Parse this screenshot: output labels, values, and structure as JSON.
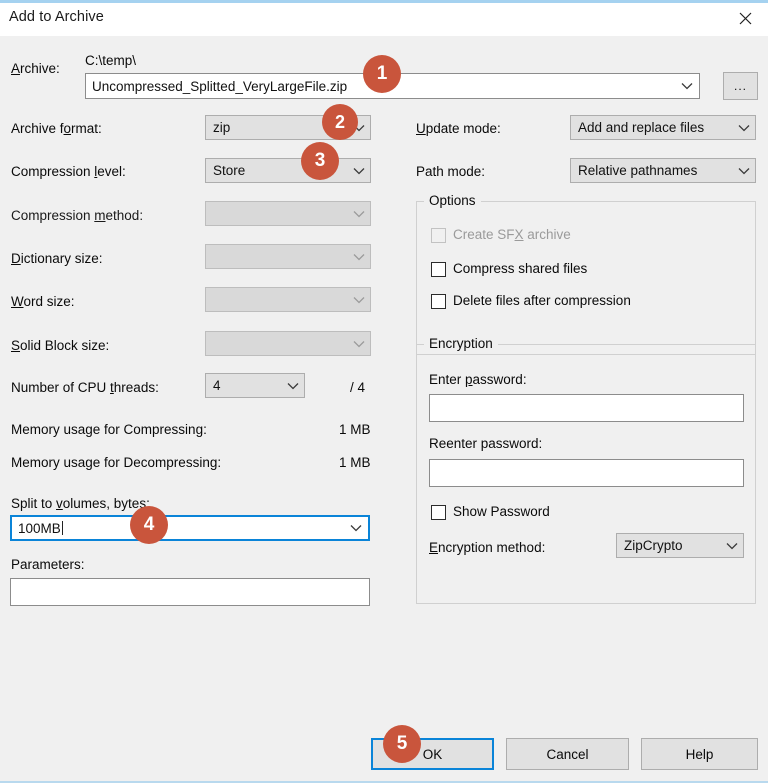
{
  "window": {
    "title": "Add to Archive",
    "close_icon": "close-icon",
    "accent_top": "#a5d2f0",
    "accent_bottom": "#b9d9ee",
    "background": "#f0f0f0",
    "focus_color": "#0a84d8",
    "badge_color": "#c9553c"
  },
  "archive": {
    "label": "Archive:",
    "path": "C:\\temp\\",
    "filename": "Uncompressed_Splitted_VeryLargeFile.zip",
    "browse_label": "...",
    "dropdown_icon": "chevron-down-icon"
  },
  "left": {
    "archive_format": {
      "label": "Archive format:",
      "value": "zip",
      "enabled": true
    },
    "compression_level": {
      "label": "Compression level:",
      "value": "Store",
      "enabled": true
    },
    "compression_method": {
      "label": "Compression method:",
      "value": "",
      "enabled": false
    },
    "dictionary_size": {
      "label": "Dictionary size:",
      "value": "",
      "enabled": false
    },
    "word_size": {
      "label": "Word size:",
      "value": "",
      "enabled": false
    },
    "solid_block_size": {
      "label": "Solid Block size:",
      "value": "",
      "enabled": false
    },
    "cpu_threads": {
      "label": "Number of CPU threads:",
      "value": "4",
      "total": "/ 4",
      "enabled": true
    },
    "memory_compressing": {
      "label": "Memory usage for Compressing:",
      "value": "1 MB"
    },
    "memory_decompressing": {
      "label": "Memory usage for Decompressing:",
      "value": "1 MB"
    },
    "split_volumes": {
      "label": "Split to volumes, bytes:",
      "value": "100MB",
      "focused": true
    },
    "parameters": {
      "label": "Parameters:",
      "value": ""
    }
  },
  "right": {
    "update_mode": {
      "label": "Update mode:",
      "value": "Add and replace files"
    },
    "path_mode": {
      "label": "Path mode:",
      "value": "Relative pathnames"
    },
    "options": {
      "title": "Options",
      "items": [
        {
          "label": "Create SFX archive",
          "checked": false,
          "enabled": false
        },
        {
          "label": "Compress shared files",
          "checked": false,
          "enabled": true
        },
        {
          "label": "Delete files after compression",
          "checked": false,
          "enabled": true
        }
      ]
    },
    "encryption": {
      "title": "Encryption",
      "enter_password_label": "Enter password:",
      "enter_password_value": "",
      "reenter_password_label": "Reenter password:",
      "reenter_password_value": "",
      "show_password_label": "Show Password",
      "show_password_checked": false,
      "method_label": "Encryption method:",
      "method_value": "ZipCrypto"
    }
  },
  "buttons": {
    "ok": "OK",
    "cancel": "Cancel",
    "help": "Help"
  },
  "annotations": [
    {
      "number": "1"
    },
    {
      "number": "2"
    },
    {
      "number": "3"
    },
    {
      "number": "4"
    },
    {
      "number": "5"
    }
  ]
}
